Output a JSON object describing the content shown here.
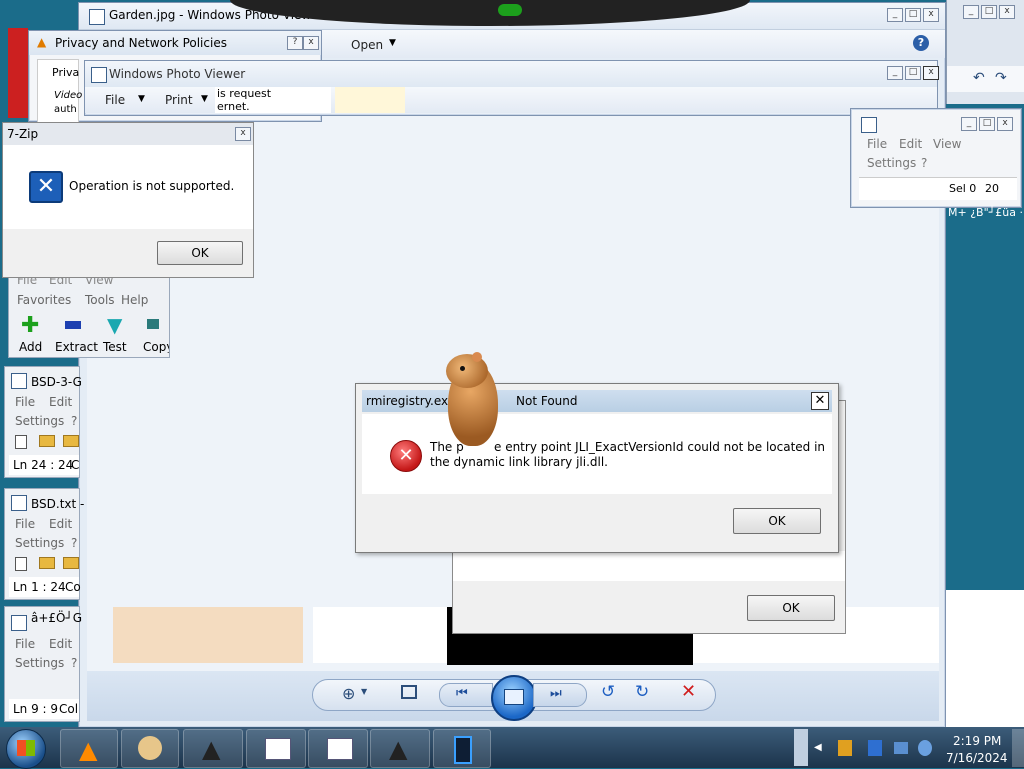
{
  "colors": {
    "desktop": "#1b6c8a",
    "taskbar": "#2a455f",
    "error": "#d01c1c",
    "dialog_title": "#b9cfe4"
  },
  "photo_viewer_main": {
    "title": "Garden.jpg - Windows Photo Viewer",
    "menu": {
      "open": "Open"
    },
    "controls": [
      "zoom-icon",
      "fit-icon",
      "previous-icon",
      "slideshow-icon",
      "next-icon",
      "rotate-left-icon",
      "rotate-right-icon",
      "delete-icon"
    ]
  },
  "photo_viewer_second": {
    "title": "Windows Photo Viewer",
    "menu": {
      "file": "File",
      "print": "Print"
    },
    "snippet_line1": "is request",
    "snippet_line2": "ernet."
  },
  "privacy_dialog": {
    "title": "Privacy and Network Policies",
    "help": "?",
    "body_text": "Priva",
    "video_line1": "Video",
    "video_line2": "auth"
  },
  "sevenzip_dialog": {
    "title": "7-Zip",
    "message": "Operation is not supported.",
    "ok": "OK"
  },
  "sevenzip_main": {
    "menu1": [
      "File",
      "Edit",
      "View"
    ],
    "menu2": [
      "Favorites",
      "Tools",
      "Help"
    ],
    "tools": [
      {
        "label": "Add",
        "icon": "add-icon"
      },
      {
        "label": "Extract",
        "icon": "extract-icon"
      },
      {
        "label": "Test",
        "icon": "test-icon"
      },
      {
        "label": "Copy",
        "icon": "copy-icon"
      }
    ]
  },
  "notepad1": {
    "title": "BSD-3-G",
    "menu1": [
      "File",
      "Edit"
    ],
    "menu2": [
      "Settings",
      "?"
    ],
    "status": "Ln 24 : 24",
    "col": "C"
  },
  "notepad2": {
    "title": "BSD.txt -",
    "menu1": [
      "File",
      "Edit"
    ],
    "menu2": [
      "Settings",
      "?"
    ],
    "status": "Ln 1 : 24",
    "col": "Co"
  },
  "notepad3": {
    "title": "â+£Ö┘G",
    "menu1": [
      "File",
      "Edit"
    ],
    "menu2": [
      "Settings",
      "?"
    ],
    "status": "Ln 9 : 9",
    "col": "Col"
  },
  "right_notepad": {
    "menu1": [
      "File",
      "Edit",
      "View"
    ],
    "menu2": [
      "Settings",
      "?"
    ],
    "sel": "Sel 0",
    "num": "20",
    "garbled": "M+ ¿B\"┘£üa ·"
  },
  "rmi_dialog": {
    "title": "rmiregistry.exe - Entry Point Not Found",
    "title_visible_left": "rmiregistry.exe -",
    "title_visible_right": "Not Found",
    "message_line1": "The procedure entry point JLI_ExactVersionId could not be located in",
    "message_line2": "the dynamic link library jli.dll.",
    "message_line1_left": "The p",
    "message_line1_right": "e entry point JLI_ExactVersionId could not be located in",
    "ok": "OK"
  },
  "back_dialog": {
    "ok": "OK"
  },
  "taskbar": {
    "time": "2:19 PM",
    "date": "7/16/2024",
    "buttons": [
      "vlc-icon",
      "paint-icon",
      "java-icon",
      "notepad-icon",
      "notepad-icon",
      "java-icon",
      "app-icon"
    ]
  }
}
